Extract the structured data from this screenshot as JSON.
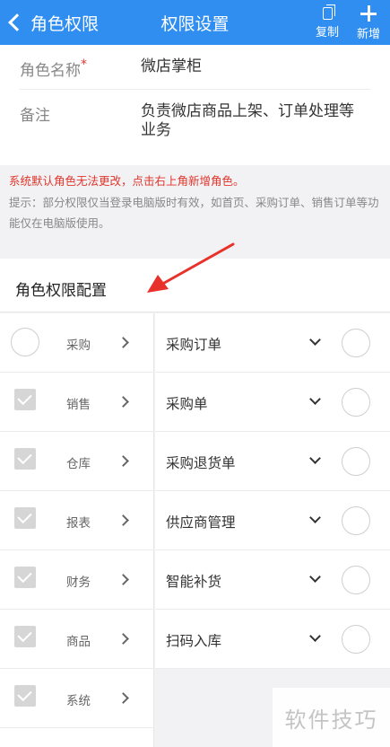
{
  "header": {
    "back_label": "角色权限",
    "title": "权限设置",
    "copy_label": "复制",
    "add_label": "新增",
    "bg_color": "#2f8ef0"
  },
  "form": {
    "role_name_label": "角色名称",
    "required_mark": "*",
    "role_name_value": "微店掌柜",
    "remark_label": "备注",
    "remark_value": "负责微店商品上架、订单处理等业务"
  },
  "notes": {
    "warning": "系统默认角色无法更改，点击右上角新增角色。",
    "tip": "提示：部分权限仅当登录电脑版时有效，如首页、采购订单、销售订单等功能仅在电脑版使用。"
  },
  "section": {
    "title": "角色权限配置"
  },
  "modules": [
    {
      "label": "采购",
      "checked": false
    },
    {
      "label": "销售",
      "checked": true
    },
    {
      "label": "仓库",
      "checked": true
    },
    {
      "label": "报表",
      "checked": true
    },
    {
      "label": "财务",
      "checked": true
    },
    {
      "label": "商品",
      "checked": true
    },
    {
      "label": "系统",
      "checked": true
    }
  ],
  "permissions": [
    {
      "label": "采购订单"
    },
    {
      "label": "采购单"
    },
    {
      "label": "采购退货单"
    },
    {
      "label": "供应商管理"
    },
    {
      "label": "智能补货"
    },
    {
      "label": "扫码入库"
    }
  ],
  "watermark": {
    "text": "软件技巧"
  },
  "icons": {
    "back": "chevron-left-icon",
    "copy": "copy-icon",
    "add": "plus-icon",
    "module_checked": "checkbox-checked-icon",
    "module_unchecked": "radio-circle-icon",
    "module_arrow": "chevron-right-icon",
    "permission_arrow": "chevron-down-icon"
  }
}
